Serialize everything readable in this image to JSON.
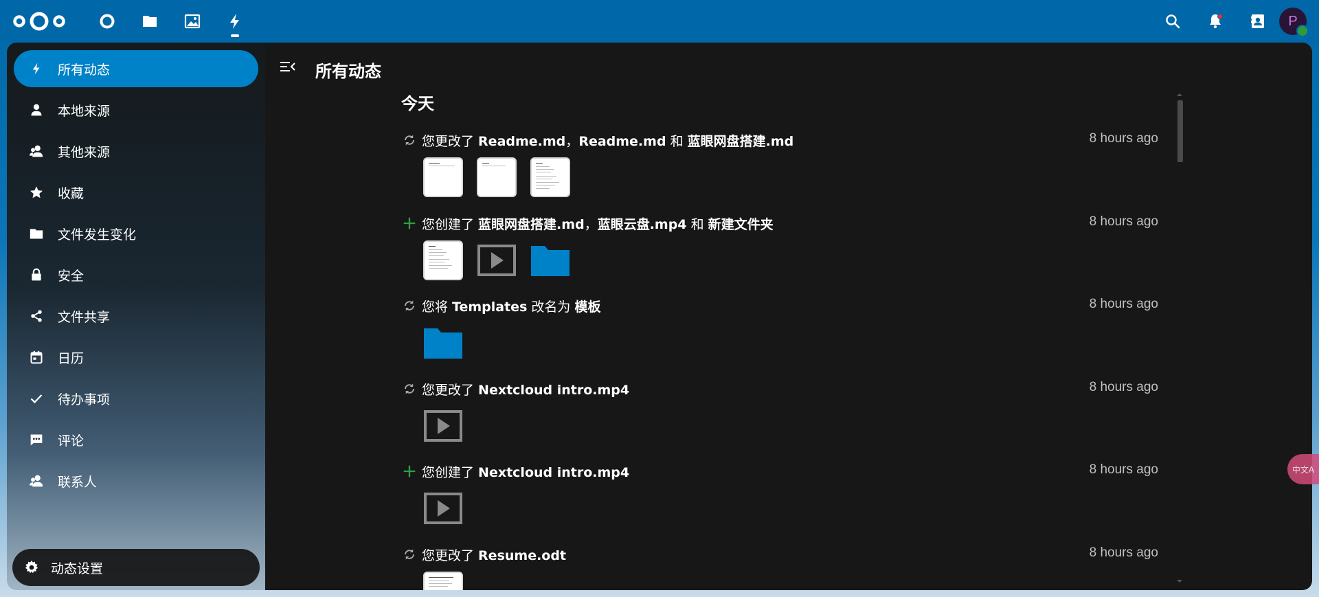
{
  "header": {
    "avatar_letter": "P"
  },
  "sidebar": {
    "items": [
      {
        "label": "所有动态",
        "icon": "lightning-icon"
      },
      {
        "label": "本地来源",
        "icon": "person-icon"
      },
      {
        "label": "其他来源",
        "icon": "people-icon"
      },
      {
        "label": "收藏",
        "icon": "star-icon"
      },
      {
        "label": "文件发生变化",
        "icon": "folder-icon"
      },
      {
        "label": "安全",
        "icon": "lock-icon"
      },
      {
        "label": "文件共享",
        "icon": "share-icon"
      },
      {
        "label": "日历",
        "icon": "calendar-icon"
      },
      {
        "label": "待办事项",
        "icon": "check-icon"
      },
      {
        "label": "评论",
        "icon": "comment-icon"
      },
      {
        "label": "联系人",
        "icon": "contacts-icon"
      }
    ],
    "settings_label": "动态设置"
  },
  "main": {
    "title": "所有动态",
    "section": "今天",
    "activities": [
      {
        "type": "changed",
        "parts": [
          "您更改了 ",
          "Readme.md",
          "，",
          "Readme.md",
          " 和 ",
          "蓝眼网盘搭建.md"
        ],
        "time": "8 hours ago"
      },
      {
        "type": "created",
        "parts": [
          "您创建了 ",
          "蓝眼网盘搭建.md",
          "，",
          "蓝眼云盘.mp4",
          " 和 ",
          "新建文件夹"
        ],
        "time": "8 hours ago"
      },
      {
        "type": "changed",
        "parts": [
          "您将 ",
          "Templates",
          " 改名为 ",
          "模板"
        ],
        "time": "8 hours ago"
      },
      {
        "type": "changed",
        "parts": [
          "您更改了 ",
          "Nextcloud intro.mp4"
        ],
        "time": "8 hours ago"
      },
      {
        "type": "created",
        "parts": [
          "您创建了 ",
          "Nextcloud intro.mp4"
        ],
        "time": "8 hours ago"
      },
      {
        "type": "changed",
        "parts": [
          "您更改了 ",
          "Resume.odt"
        ],
        "time": "8 hours ago"
      }
    ]
  },
  "translate_fab": "中文A",
  "colors": {
    "header_bg": "#0068a8",
    "accent": "#0082c9",
    "folder": "#0082c9",
    "created_icon": "#2ea043",
    "main_bg": "#171717"
  }
}
